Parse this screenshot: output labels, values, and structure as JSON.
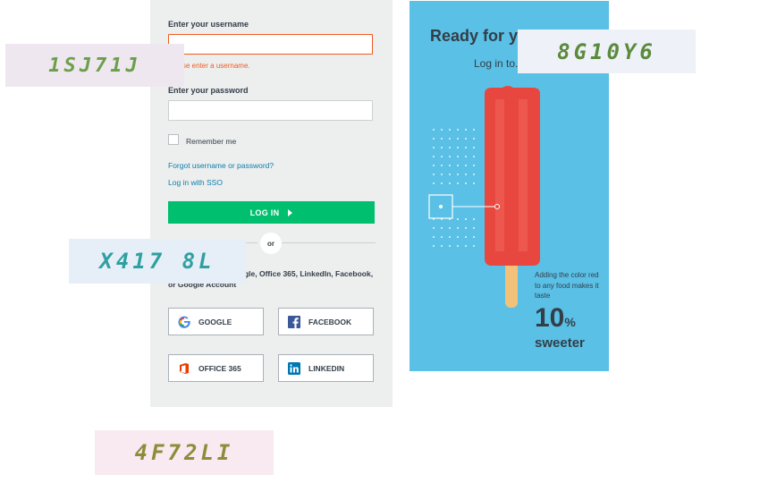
{
  "form": {
    "username_label": "Enter your username",
    "username_value": "",
    "username_error": "Please enter a username.",
    "password_label": "Enter your password",
    "password_value": "",
    "remember_label": "Remember me",
    "forgot_link": "Forgot username or password?",
    "sso_link": "Log in with SSO",
    "login_button": "LOG IN",
    "or_label": "or",
    "social_text": "Log in with your Google, Office 365, LinkedIn, Facebook, or Google Account"
  },
  "social": {
    "google": "GOOGLE",
    "facebook": "FACEBOOK",
    "office": "OFFICE 365",
    "linkedin": "LINKEDIN"
  },
  "hero": {
    "title": "Ready for your...",
    "subtitle": "Log in to...",
    "fact": "Adding the color red to any food makes it taste",
    "big_number": "10",
    "percent": "%",
    "big_word": "sweeter"
  },
  "captchas": [
    {
      "text": "1SJ71J"
    },
    {
      "text": "8G10Y6"
    },
    {
      "text": "X417 8L"
    },
    {
      "text": "4F72LI"
    }
  ],
  "colors": {
    "accent_green": "#00bf6f",
    "error_orange": "#f05b24",
    "link_blue": "#0a7fae",
    "hero_blue": "#5ac0e6",
    "captcha_green": "#5b8a3c"
  }
}
